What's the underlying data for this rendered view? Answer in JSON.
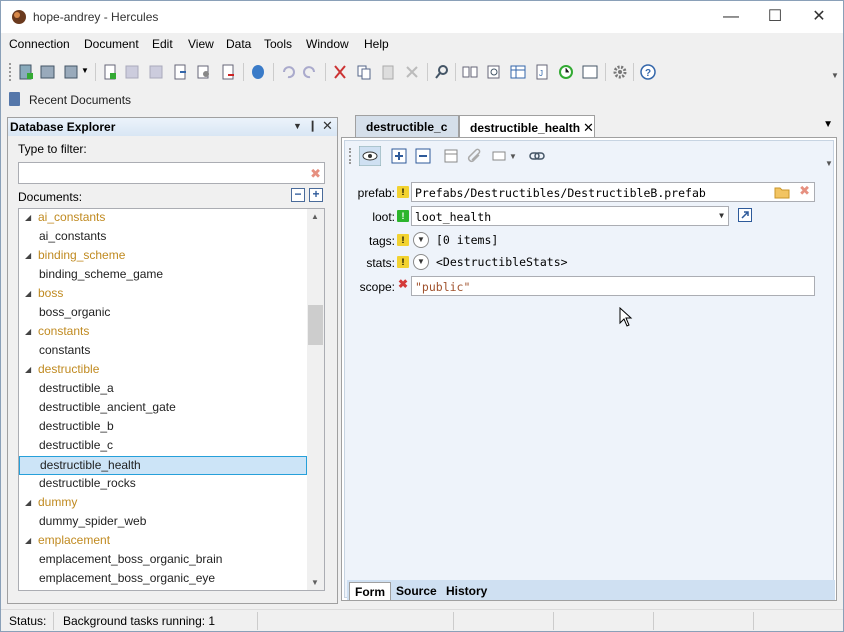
{
  "window": {
    "title": "hope-andrey - Hercules"
  },
  "menubar": [
    "Connection",
    "Document",
    "Edit",
    "View",
    "Data",
    "Tools",
    "Window",
    "Help"
  ],
  "recent": {
    "label": "Recent Documents"
  },
  "explorer": {
    "title": "Database Explorer",
    "filter_label": "Type to filter:",
    "filter_value": "",
    "documents_label": "Documents:",
    "tree": [
      {
        "label": "ai_constants",
        "kind": "group"
      },
      {
        "label": "ai_constants",
        "kind": "doc"
      },
      {
        "label": "binding_scheme",
        "kind": "group"
      },
      {
        "label": "binding_scheme_game",
        "kind": "doc"
      },
      {
        "label": "boss",
        "kind": "group"
      },
      {
        "label": "boss_organic",
        "kind": "doc"
      },
      {
        "label": "constants",
        "kind": "group"
      },
      {
        "label": "constants",
        "kind": "doc"
      },
      {
        "label": "destructible",
        "kind": "group"
      },
      {
        "label": "destructible_a",
        "kind": "doc"
      },
      {
        "label": "destructible_ancient_gate",
        "kind": "doc"
      },
      {
        "label": "destructible_b",
        "kind": "doc"
      },
      {
        "label": "destructible_c",
        "kind": "doc"
      },
      {
        "label": "destructible_health",
        "kind": "doc",
        "selected": true
      },
      {
        "label": "destructible_rocks",
        "kind": "doc"
      },
      {
        "label": "dummy",
        "kind": "group"
      },
      {
        "label": "dummy_spider_web",
        "kind": "doc"
      },
      {
        "label": "emplacement",
        "kind": "group"
      },
      {
        "label": "emplacement_boss_organic_brain",
        "kind": "doc"
      },
      {
        "label": "emplacement_boss_organic_eye",
        "kind": "doc"
      }
    ]
  },
  "tabs": [
    {
      "label": "destructible_c",
      "active": false
    },
    {
      "label": "destructible_health",
      "active": true
    }
  ],
  "form": {
    "prefab": {
      "label": "prefab:",
      "value": "Prefabs/Destructibles/DestructibleB.prefab"
    },
    "loot": {
      "label": "loot:",
      "value": "loot_health"
    },
    "tags": {
      "label": "tags:",
      "value": "[0 items]"
    },
    "stats": {
      "label": "stats:",
      "value": "<DestructibleStats>"
    },
    "scope": {
      "label": "scope:",
      "value": "\"public\""
    }
  },
  "bottom_tabs": [
    "Form",
    "Source",
    "History"
  ],
  "status": {
    "label": "Status:",
    "text": "Background tasks running: 1"
  },
  "colors": {
    "group": "#c08a20",
    "selection": "#cce4f7",
    "header": "#d8e6f4"
  }
}
